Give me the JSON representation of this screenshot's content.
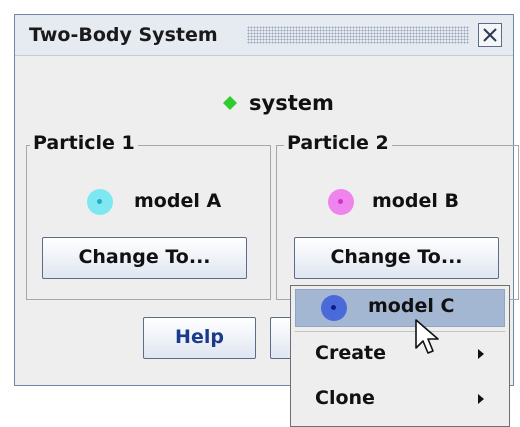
{
  "window": {
    "title": "Two-Body System"
  },
  "system": {
    "label": "system",
    "icon": "green-diamond-icon",
    "color": "#2ecc2e"
  },
  "particles": [
    {
      "title": "Particle 1",
      "model": "model A",
      "dot_color": "#7ee8f0",
      "button": "Change To..."
    },
    {
      "title": "Particle 2",
      "model": "model B",
      "dot_color": "#ee84ec",
      "button": "Change To..."
    }
  ],
  "footer": {
    "help_label": "Help",
    "partial_button_label": ""
  },
  "popup_menu": {
    "items": [
      {
        "label": "model C",
        "selected": true,
        "dot_color": "#4b6ad9"
      },
      {
        "label": "Create",
        "submenu": true
      },
      {
        "label": "Clone",
        "submenu": true
      }
    ]
  },
  "colors": {
    "selection": "#a4b7d2",
    "panel_bg": "#eeeeee",
    "button_border": "#5d6d89"
  }
}
